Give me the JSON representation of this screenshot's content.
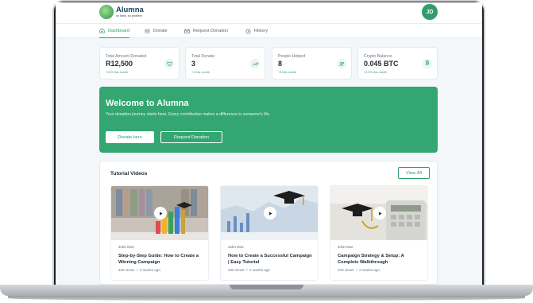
{
  "header": {
    "brand": "Alumna",
    "tagline": "no bank, no problem",
    "avatar_initials": "JD",
    "accent_color": "#2f9e6b"
  },
  "nav": {
    "tabs": [
      {
        "label": "Dashboard",
        "icon": "home-icon",
        "active": true
      },
      {
        "label": "Donate",
        "icon": "coins-icon",
        "active": false
      },
      {
        "label": "Request Donation",
        "icon": "mail-icon",
        "active": false
      },
      {
        "label": "History",
        "icon": "history-icon",
        "active": false
      }
    ]
  },
  "stats": [
    {
      "label": "Total Amount Donated",
      "value": "R12,500",
      "change": "+12% this month",
      "icon": "heart-icon"
    },
    {
      "label": "Total Donate",
      "value": "3",
      "change": "+1 this month",
      "icon": "trending-up-icon"
    },
    {
      "label": "People Helped",
      "value": "8",
      "change": "+3 this month",
      "icon": "users-icon"
    },
    {
      "label": "Crypto Balance",
      "value": "0.045 BTC",
      "change": "+5.2% this month",
      "icon": "bitcoin-icon"
    }
  ],
  "welcome": {
    "title": "Welcome to Alumna",
    "text": "Your donation journey starts here. Every contribution makes a difference in someone's life.",
    "donate_button": "Donate here",
    "request_button": "Request Donation"
  },
  "tutorials": {
    "title": "Tutorial Videos",
    "view_all": "View  All",
    "videos": [
      {
        "author": "John Doe",
        "title": "Step-by-Step Guide: How to Create a Winning Campaign",
        "views": "345 views",
        "age": "2 weeks ago"
      },
      {
        "author": "John Doe",
        "title": "How to Create a Successful Campaign | Easy Tutorial",
        "views": "345 views",
        "age": "2 weeks ago"
      },
      {
        "author": "John Doe",
        "title": "Campaign Strategy & Setup: A Complete Walkthrough",
        "views": "345 views",
        "age": "2 weeks ago"
      }
    ]
  }
}
